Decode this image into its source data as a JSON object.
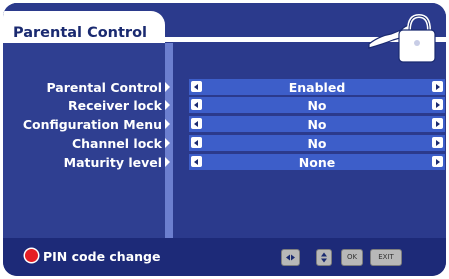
{
  "header": {
    "title": "Parental Control"
  },
  "rows": [
    {
      "label": "Parental Control",
      "value": "Enabled"
    },
    {
      "label": "Receiver lock",
      "value": "No"
    },
    {
      "label": "Configuration Menu",
      "value": "No"
    },
    {
      "label": "Channel lock",
      "value": "No"
    },
    {
      "label": "Maturity level",
      "value": "None"
    }
  ],
  "footer": {
    "pin_change_label": "PIN code change",
    "ok_key": "OK",
    "exit_key": "EXIT"
  },
  "colors": {
    "background": "#2b3a8c",
    "value_field": "#3d5ec9",
    "red_button": "#e51e25"
  },
  "icons": [
    "padlock-key-icon",
    "red-button-icon",
    "left-right-keys-icon",
    "up-down-keys-icon"
  ]
}
